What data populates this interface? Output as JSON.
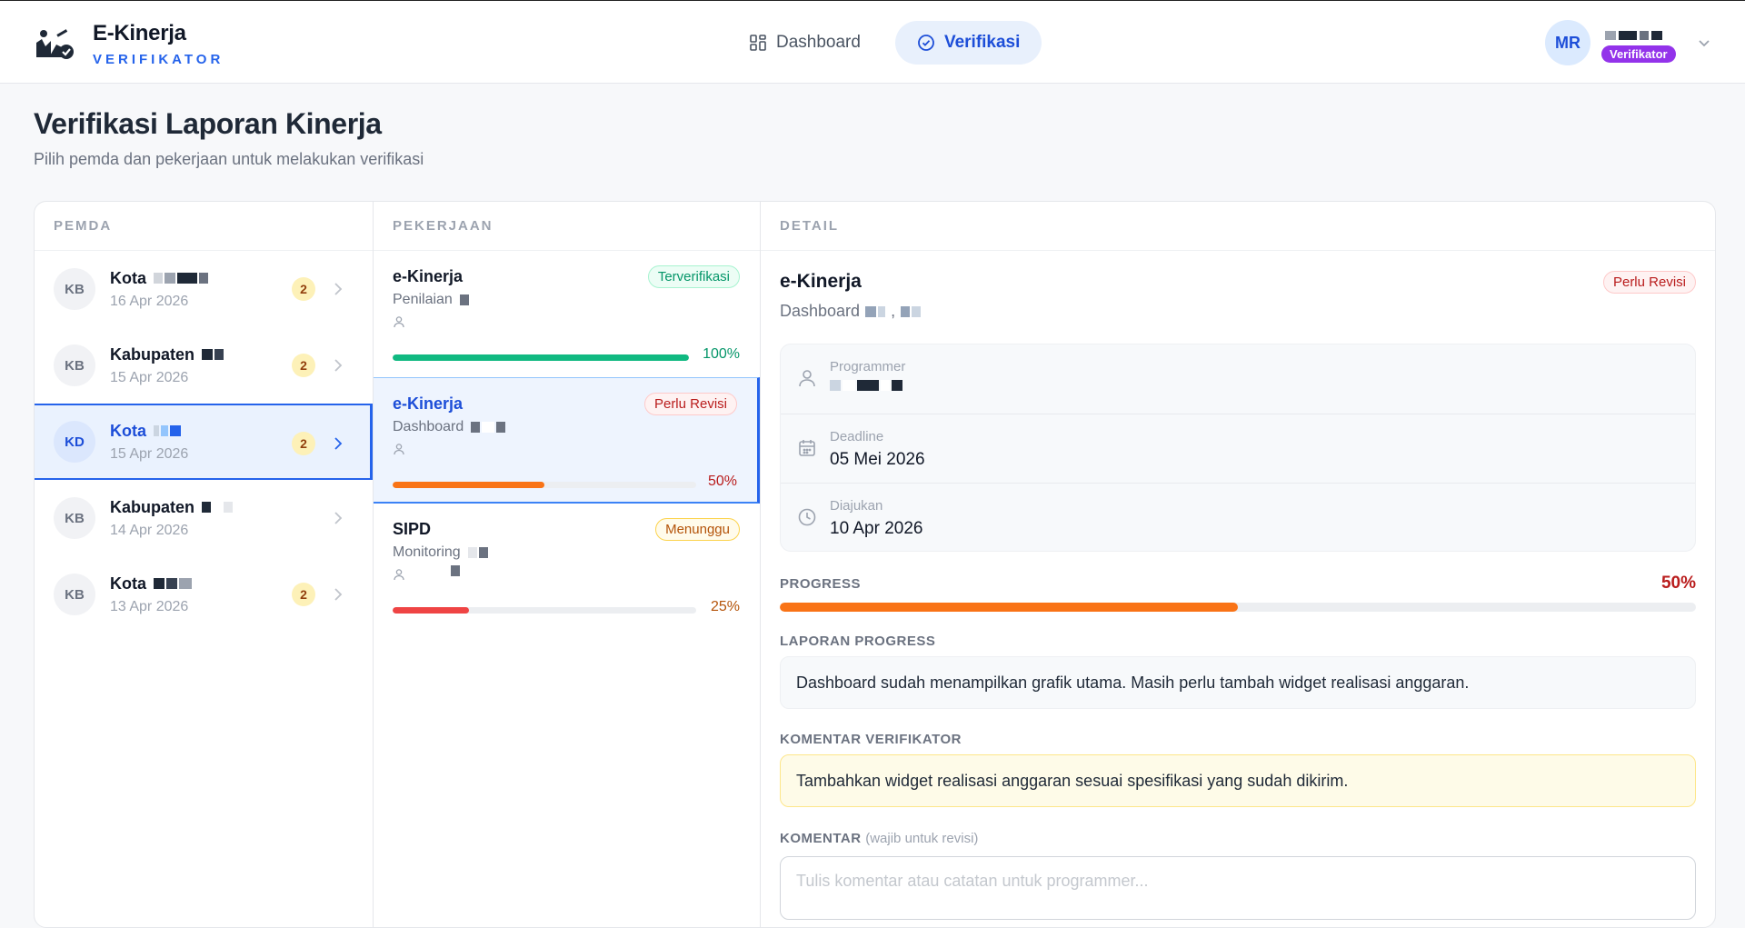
{
  "header": {
    "brand_title": "E-Kinerja",
    "brand_subtitle": "VERIFIKATOR",
    "nav": [
      {
        "label": "Dashboard",
        "icon": "grid-icon",
        "active": false
      },
      {
        "label": "Verifikasi",
        "icon": "check-circle-icon",
        "active": true
      }
    ],
    "user": {
      "initials": "MR",
      "role": "Verifikator"
    }
  },
  "page": {
    "title": "Verifikasi Laporan Kinerja",
    "subtitle": "Pilih pemda dan pekerjaan untuk melakukan verifikasi"
  },
  "pemda": {
    "heading": "PEMDA",
    "items": [
      {
        "initials": "KB",
        "name": "Kota",
        "date": "16 Apr 2026",
        "count": "2",
        "active": false
      },
      {
        "initials": "KB",
        "name": "Kabupaten",
        "date": "15 Apr 2026",
        "count": "2",
        "active": false
      },
      {
        "initials": "KD",
        "name": "Kota",
        "date": "15 Apr 2026",
        "count": "2",
        "active": true
      },
      {
        "initials": "KB",
        "name": "Kabupaten",
        "date": "14 Apr 2026",
        "count": "",
        "active": false
      },
      {
        "initials": "KB",
        "name": "Kota",
        "date": "13 Apr 2026",
        "count": "2",
        "active": false
      }
    ]
  },
  "pekerjaan": {
    "heading": "PEKERJAAN",
    "items": [
      {
        "title": "e-Kinerja",
        "module": "Penilaian",
        "status": "Terverifikasi",
        "status_color": "#059669",
        "progress_label": "100%",
        "progress": 1.0,
        "bar_color": "#10b981",
        "active": false
      },
      {
        "title": "e-Kinerja",
        "module": "Dashboard",
        "status": "Perlu Revisi",
        "status_color": "#b91c1c",
        "progress_label": "50%",
        "progress": 0.5,
        "bar_color": "#f97316",
        "active": true
      },
      {
        "title": "SIPD",
        "module": "Monitoring",
        "status": "Menunggu",
        "status_color": "#b45309",
        "progress_label": "25%",
        "progress": 0.25,
        "bar_color": "#ef4444",
        "active": false
      }
    ]
  },
  "detail": {
    "heading": "DETAIL",
    "title": "e-Kinerja",
    "status": "Perlu Revisi",
    "module": "Dashboard",
    "programmer_label": "Programmer",
    "deadline_label": "Deadline",
    "deadline_value": "05 Mei 2026",
    "submitted_label": "Diajukan",
    "submitted_value": "10 Apr 2026",
    "progress_label": "PROGRESS",
    "progress_value": "50%",
    "progress": 0.5,
    "report_label": "LAPORAN PROGRESS",
    "report_text": "Dashboard sudah menampilkan grafik utama. Masih perlu tambah widget realisasi anggaran.",
    "verifier_comment_label": "KOMENTAR VERIFIKATOR",
    "verifier_comment_text": "Tambahkan widget realisasi anggaran sesuai spesifikasi yang sudah dikirim.",
    "comment_label": "KOMENTAR",
    "comment_hint": "(wajib untuk revisi)",
    "comment_placeholder": "Tulis komentar atau catatan untuk programmer..."
  },
  "colors": {
    "accent": "#2563eb",
    "role_badge": "#9333ea",
    "count_badge": "#fdf1b8"
  }
}
